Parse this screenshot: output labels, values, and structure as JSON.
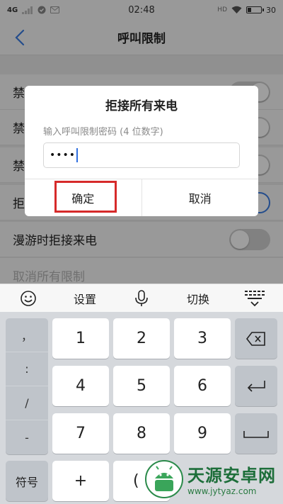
{
  "status_bar": {
    "network": "4G",
    "time": "02:48",
    "battery": "30",
    "battery_level": 0.3
  },
  "nav": {
    "title": "呼叫限制"
  },
  "settings": {
    "rows": [
      {
        "label": "禁",
        "state": "off"
      },
      {
        "label": "禁",
        "state": "off"
      },
      {
        "label": "禁",
        "state": "off"
      },
      {
        "label": "拒",
        "state": "on"
      },
      {
        "label": "漫游时拒接来电",
        "state": "off"
      },
      {
        "label": "取消所有限制",
        "state": "none"
      }
    ]
  },
  "dialog": {
    "title": "拒接所有来电",
    "hint": "输入呼叫限制密码 (4 位数字)",
    "password_value": "••••",
    "confirm_label": "确定",
    "cancel_label": "取消"
  },
  "keyboard_toolbar": {
    "settings_label": "设置",
    "switch_label": "切换"
  },
  "keyboard": {
    "symbols": [
      "，",
      ":",
      "/",
      "-"
    ],
    "digits": [
      "1",
      "2",
      "3",
      "4",
      "5",
      "6",
      "7",
      "8",
      "9"
    ],
    "symbol_key": "符号",
    "plus_key": "+",
    "zero_partial": "("
  },
  "watermark": {
    "name": "天源安卓网",
    "url": "www.jytyaz.com"
  },
  "colors": {
    "accent": "#3b7de3",
    "highlight": "#d62a2a",
    "watermark": "#1d6e3a"
  }
}
